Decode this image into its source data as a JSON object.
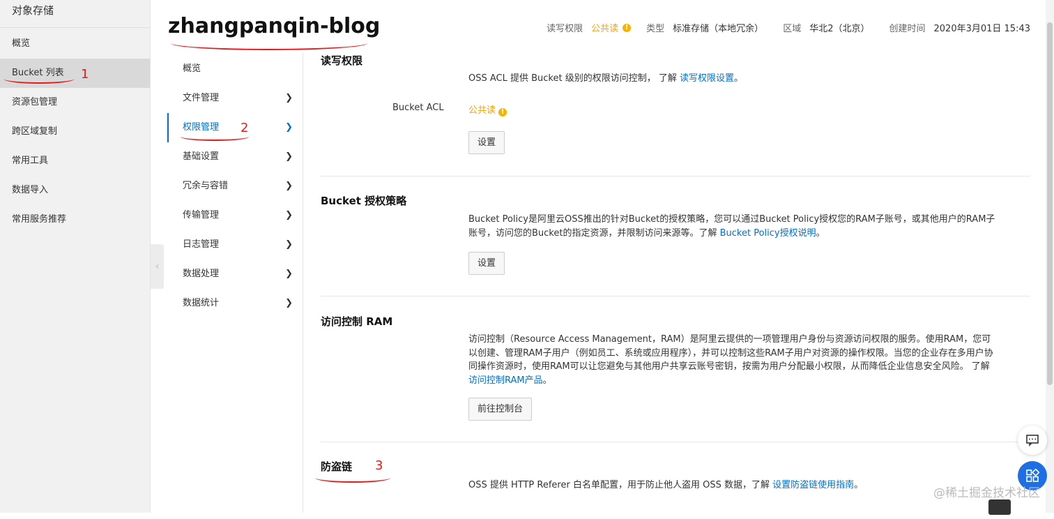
{
  "sidebar": {
    "title": "对象存储",
    "items": [
      {
        "label": "概览"
      },
      {
        "label": "Bucket 列表"
      },
      {
        "label": "资源包管理"
      },
      {
        "label": "跨区域复制"
      },
      {
        "label": "常用工具"
      },
      {
        "label": "数据导入"
      },
      {
        "label": "常用服务推荐"
      }
    ]
  },
  "header": {
    "bucket_name": "zhangpanqin-blog",
    "acl_key": "读写权限",
    "acl_value": "公共读",
    "type_key": "类型",
    "type_value": "标准存储（本地冗余）",
    "region_key": "区域",
    "region_value": "华北2（北京）",
    "created_key": "创建时间",
    "created_value": "2020年3月01日 15:43"
  },
  "subnav": {
    "items": [
      {
        "label": "概览"
      },
      {
        "label": "文件管理"
      },
      {
        "label": "权限管理"
      },
      {
        "label": "基础设置"
      },
      {
        "label": "冗余与容错"
      },
      {
        "label": "传输管理"
      },
      {
        "label": "日志管理"
      },
      {
        "label": "数据处理"
      },
      {
        "label": "数据统计"
      }
    ]
  },
  "sections": {
    "acl": {
      "title": "读写权限",
      "desc": "OSS ACL 提供 Bucket 级别的权限访问控制， 了解 ",
      "link": "读写权限设置",
      "desc_end": "。",
      "label": "Bucket ACL",
      "value": "公共读",
      "button": "设置"
    },
    "policy": {
      "title": "Bucket 授权策略",
      "desc": "Bucket Policy是阿里云OSS推出的针对Bucket的授权策略，您可以通过Bucket Policy授权您的RAM子账号，或其他用户的RAM子账号，访问您的Bucket的指定资源，并限制访问来源等。了解 ",
      "link": "Bucket Policy授权说明",
      "desc_end": "。",
      "button": "设置"
    },
    "ram": {
      "title": "访问控制 RAM",
      "desc": "访问控制（Resource Access Management，RAM）是阿里云提供的一项管理用户身份与资源访问权限的服务。使用RAM，您可以创建、管理RAM子用户（例如员工、系统或应用程序），并可以控制这些RAM子用户对资源的操作权限。当您的企业存在多用户协同操作资源时，使用RAM可以让您避免与其他用户共享云账号密钥，按需为用户分配最小权限，从而降低企业信息安全风险。 了解 ",
      "link": "访问控制RAM产品",
      "desc_end": "。",
      "button": "前往控制台"
    },
    "hotlink": {
      "title": "防盗链",
      "desc": "OSS 提供 HTTP Referer 白名单配置，用于防止他人盗用 OSS 数据，了解 ",
      "link": "设置防盗链使用指南",
      "desc_end": "。"
    }
  },
  "annotations": {
    "one": "1",
    "two": "2",
    "three": "3"
  },
  "watermark": "@稀土掘金技术社区",
  "colors": {
    "accent": "#0070cc",
    "warning": "#f4a20c",
    "annotation": "#e21c1c",
    "fab": "#1f6fe4"
  }
}
